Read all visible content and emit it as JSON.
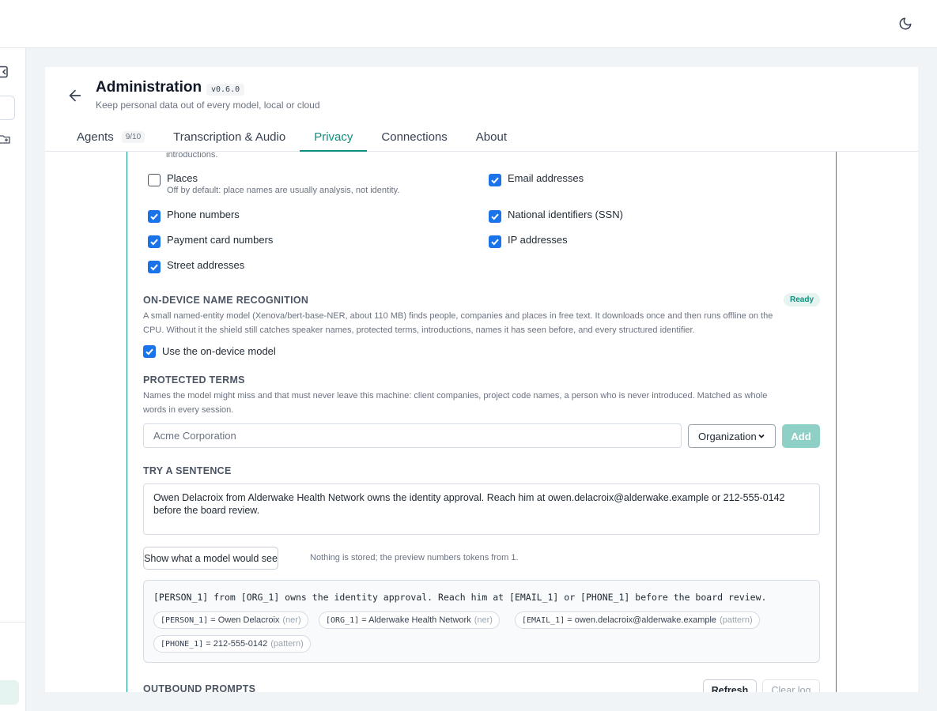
{
  "icons": {
    "theme": "moon-icon",
    "back": "arrow-left-icon",
    "sidebar_collapse": "sidebar-collapse-icon",
    "sidebar_folder": "folder-plus-icon",
    "checkbox": "checkmark-icon"
  },
  "colors": {
    "accent": "#0f8f7f",
    "checkbox": "#1a73e8",
    "add_button": "#8fd0c6"
  },
  "header": {
    "title": "Administration",
    "version": "v0.6.0",
    "subtitle": "Keep personal data out of every model, local or cloud"
  },
  "tabs": [
    {
      "label": "Agents",
      "count": "9/10"
    },
    {
      "label": "Transcription & Audio"
    },
    {
      "label": "Privacy",
      "active": true
    },
    {
      "label": "Connections"
    },
    {
      "label": "About"
    }
  ],
  "privacy": {
    "truncated_text": "introductions.",
    "categories": [
      {
        "label": "Places",
        "hint": "Off by default: place names are usually analysis, not identity.",
        "checked": false
      },
      {
        "label": "Email addresses",
        "checked": true
      },
      {
        "label": "Phone numbers",
        "checked": true
      },
      {
        "label": "National identifiers (SSN)",
        "checked": true
      },
      {
        "label": "Payment card numbers",
        "checked": true
      },
      {
        "label": "IP addresses",
        "checked": true
      },
      {
        "label": "Street addresses",
        "checked": true
      }
    ],
    "ner": {
      "heading": "ON-DEVICE NAME RECOGNITION",
      "status": "Ready",
      "line1": "A small named-entity model (Xenova/bert-base-NER, about 110 MB) finds people, companies and places in free text. It downloads once and then runs offline on the",
      "line2": "CPU. Without it the shield still catches speaker names, protected terms, introductions, names it has seen before, and every structured identifier.",
      "toggle_label": "Use the on-device model",
      "toggle_checked": true
    },
    "terms": {
      "heading": "PROTECTED TERMS",
      "line1": "Names the model might miss and that must never leave this machine: client companies, project code names, a person who is never introduced. Matched as whole",
      "line2": "words in every session.",
      "input_placeholder": "Acme Corporation",
      "type_selected": "Organization",
      "add_label": "Add"
    },
    "try": {
      "heading": "TRY A SENTENCE",
      "sentence_line1": "Owen Delacroix from Alderwake Health Network owns the identity approval. Reach him at owen.delacroix@alderwake.example or 212-555-0142",
      "sentence_line2": "before the board review.",
      "button_label": "Show what a model would see",
      "note": "Nothing is stored; the preview numbers tokens from 1."
    },
    "preview": {
      "masked": "[PERSON_1] from [ORG_1] owns the identity approval. Reach him at [EMAIL_1] or [PHONE_1] before the board review.",
      "mappings": [
        {
          "token": "[PERSON_1]",
          "value": "= Owen Delacroix",
          "source": "(ner)"
        },
        {
          "token": "[ORG_1]",
          "value": "= Alderwake Health Network",
          "source": "(ner)"
        },
        {
          "token": "[EMAIL_1]",
          "value": "= owen.delacroix@alderwake.example",
          "source": "(pattern)"
        },
        {
          "token": "[PHONE_1]",
          "value": "= 212-555-0142",
          "source": "(pattern)"
        }
      ]
    },
    "outbound": {
      "heading": "OUTBOUND PROMPTS",
      "refresh_label": "Refresh",
      "clear_label": "Clear log"
    }
  }
}
